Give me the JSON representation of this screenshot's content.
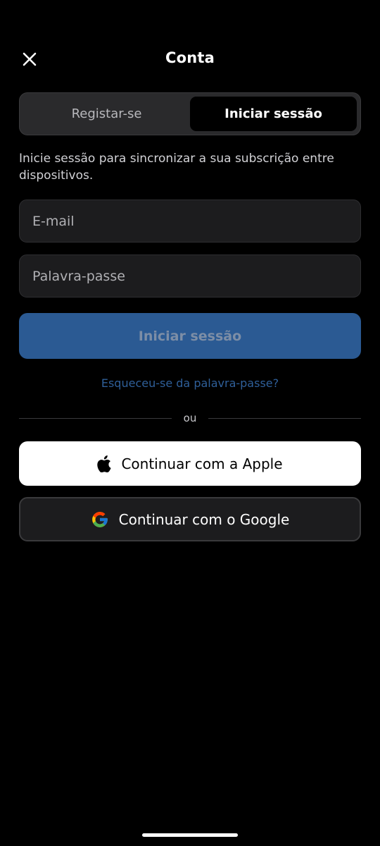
{
  "header": {
    "title": "Conta",
    "close_icon": "close-icon"
  },
  "tabs": [
    {
      "label": "Registar-se",
      "selected": false
    },
    {
      "label": "Iniciar sessão",
      "selected": true
    }
  ],
  "description": "Inicie sessão para sincronizar a sua subscrição entre dispositivos.",
  "form": {
    "email": {
      "value": "",
      "placeholder": "E-mail"
    },
    "password": {
      "value": "",
      "placeholder": "Palavra-passe"
    },
    "submit_label": "Iniciar sessão",
    "forgot_label": "Esqueceu-se da palavra-passe?"
  },
  "divider": {
    "text": "ou"
  },
  "social": {
    "apple": {
      "label": "Continuar com a Apple",
      "icon": "apple-icon"
    },
    "google": {
      "label": "Continuar com o Google",
      "icon": "google-icon"
    }
  },
  "colors": {
    "background": "#000000",
    "primary_button": "#2b5a93",
    "link": "#2f5f99",
    "field_background": "#1c1c1e"
  }
}
